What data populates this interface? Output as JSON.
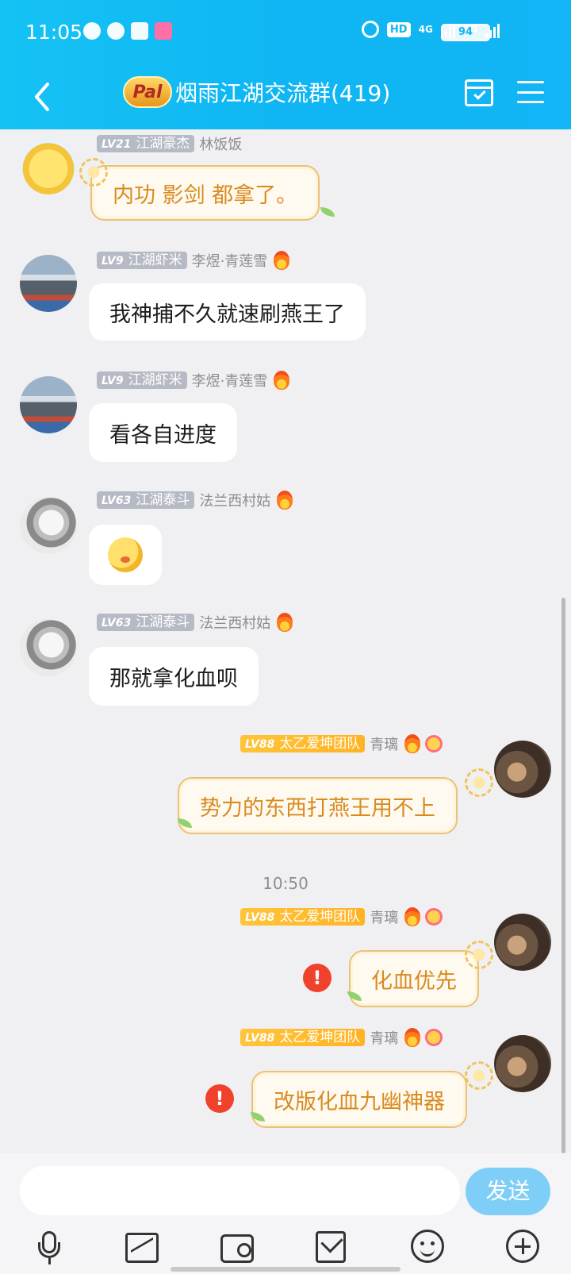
{
  "status_bar": {
    "time": "11:05",
    "hd": "HD",
    "net1": "4G",
    "net2": "4G",
    "battery": "94"
  },
  "header": {
    "title": "烟雨江湖交流群(419)",
    "badge": "Pal"
  },
  "messages": [
    {
      "side": "left",
      "level": "LV21",
      "rank": "江湖豪杰",
      "nick": "林饭饭",
      "text": "内功 影剑 都拿了。"
    },
    {
      "side": "left",
      "level": "LV9",
      "rank": "江湖虾米",
      "nick": "李煜·青莲雪",
      "text": "我神捕不久就速刷燕王了"
    },
    {
      "side": "left",
      "level": "LV9",
      "rank": "江湖虾米",
      "nick": "李煜·青莲雪",
      "text": "看各自进度"
    },
    {
      "side": "left",
      "level": "LV63",
      "rank": "江湖泰斗",
      "nick": "法兰西村姑",
      "text": ""
    },
    {
      "side": "left",
      "level": "LV63",
      "rank": "江湖泰斗",
      "nick": "法兰西村姑",
      "text": "那就拿化血呗"
    },
    {
      "side": "right",
      "level": "LV88",
      "rank": "太乙爱坤团队",
      "nick": "青璃",
      "text": "势力的东西打燕王用不上"
    },
    {
      "side": "right",
      "level": "LV88",
      "rank": "太乙爱坤团队",
      "nick": "青璃",
      "text": "化血优先"
    },
    {
      "side": "right",
      "level": "LV88",
      "rank": "太乙爱坤团队",
      "nick": "青璃",
      "text": "改版化血九幽神器"
    }
  ],
  "timestamp": "10:50",
  "input": {
    "send_label": "发送",
    "placeholder": ""
  },
  "error_mark": "!",
  "icons": [
    "back-icon",
    "calendar-check-icon",
    "menu-icon",
    "mic-icon",
    "image-icon",
    "camera-icon",
    "redpacket-icon",
    "emoji-icon",
    "plus-icon"
  ],
  "colors": {
    "header": "#12b9f4",
    "send": "#7fcef7",
    "fancy_text": "#d98a1f",
    "error": "#f0412c"
  }
}
